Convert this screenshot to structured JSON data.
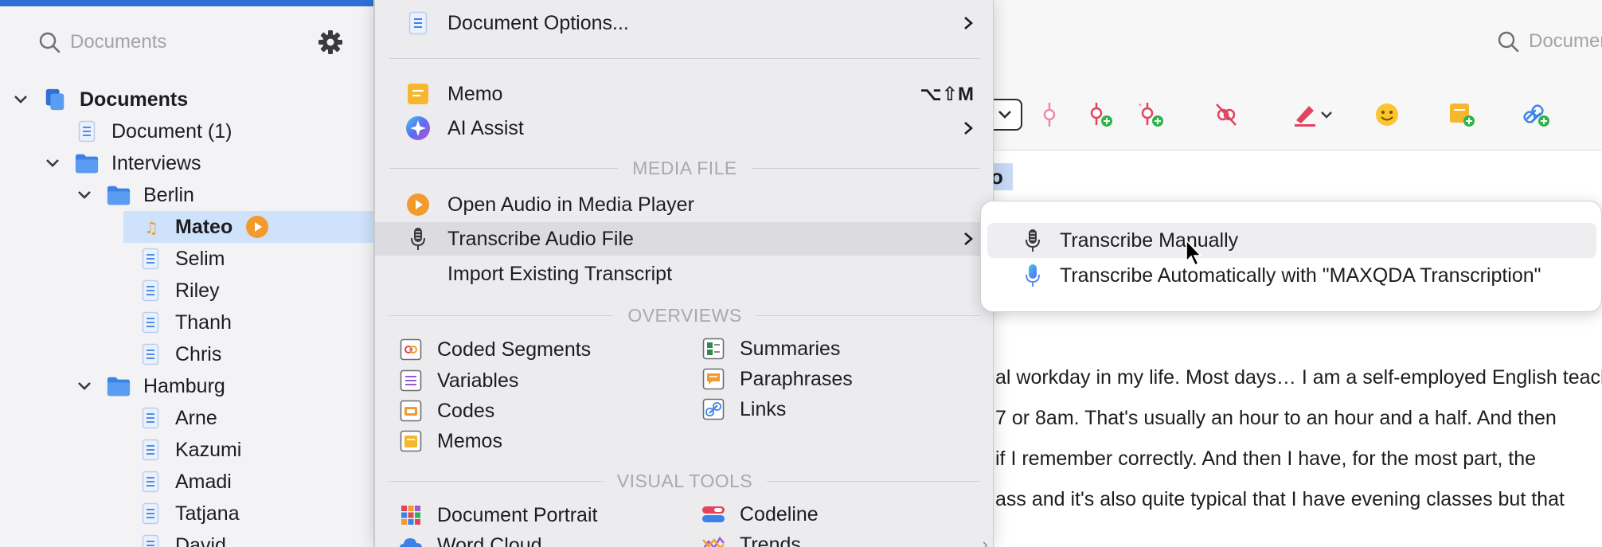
{
  "left_panel": {
    "search_placeholder": "Documents",
    "tree": [
      {
        "label": "Documents",
        "level": 0,
        "expanded": true,
        "icon": "documents-stack-icon",
        "bold": true
      },
      {
        "label": "Document (1)",
        "level": 1,
        "icon": "text-document-icon"
      },
      {
        "label": "Interviews",
        "level": 1,
        "expanded": true,
        "icon": "folder-icon"
      },
      {
        "label": "Berlin",
        "level": 2,
        "expanded": true,
        "icon": "folder-icon"
      },
      {
        "label": "Mateo",
        "level": 3,
        "icon": "audio-document-icon",
        "bold": true,
        "selected": true,
        "badge": "play-badge-icon"
      },
      {
        "label": "Selim",
        "level": 3,
        "icon": "text-document-icon"
      },
      {
        "label": "Riley",
        "level": 3,
        "icon": "text-document-icon"
      },
      {
        "label": "Thanh",
        "level": 3,
        "icon": "text-document-icon"
      },
      {
        "label": "Chris",
        "level": 3,
        "icon": "text-document-icon"
      },
      {
        "label": "Hamburg",
        "level": 2,
        "expanded": true,
        "icon": "folder-icon"
      },
      {
        "label": "Arne",
        "level": 3,
        "icon": "text-document-icon"
      },
      {
        "label": "Kazumi",
        "level": 3,
        "icon": "text-document-icon"
      },
      {
        "label": "Amadi",
        "level": 3,
        "icon": "text-document-icon"
      },
      {
        "label": "Tatjana",
        "level": 3,
        "icon": "text-document-icon"
      },
      {
        "label": "David",
        "level": 3,
        "icon": "text-document-icon"
      }
    ]
  },
  "menu": {
    "document_options": "Document Options...",
    "memo": "Memo",
    "memo_shortcut": "⌥⇧M",
    "ai_assist": "AI Assist",
    "section_media": "MEDIA FILE",
    "open_audio": "Open Audio in Media Player",
    "transcribe_audio": "Transcribe Audio File",
    "import_transcript": "Import Existing Transcript",
    "section_overviews": "OVERVIEWS",
    "overviews_left": [
      "Coded Segments",
      "Variables",
      "Codes",
      "Memos"
    ],
    "overviews_right": [
      "Summaries",
      "Paraphrases",
      "Links"
    ],
    "section_visual": "VISUAL TOOLS",
    "visual_left": [
      "Document Portrait",
      "Word Cloud"
    ],
    "visual_right": [
      "Codeline",
      "Trends"
    ]
  },
  "submenu": {
    "manual": "Transcribe Manually",
    "automatic": "Transcribe Automatically with \"MAXQDA Transcription\""
  },
  "document": {
    "search_placeholder": "Documents",
    "title_fragment": "o",
    "lines": [
      "al workday in my life. Most days… I am a self-employed English teacher",
      " 7 or 8am. That's usually an hour to an hour and a half. And then",
      "if I remember correctly. And then I have, for the most part, the",
      "ass and it's also quite typical that I have evening classes but that"
    ]
  },
  "colors": {
    "accent": "#2f6fd6",
    "selection": "#cfe2fb",
    "folder": "#3c82e6",
    "orange": "#f39a2c",
    "memo_yellow": "#f6b72d"
  }
}
